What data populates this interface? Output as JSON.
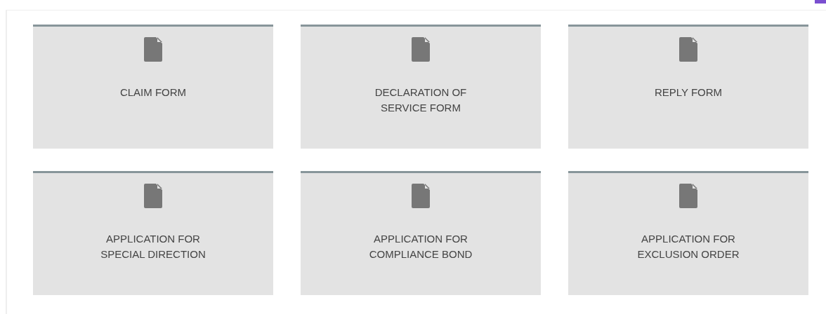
{
  "forms": [
    {
      "label": "CLAIM FORM"
    },
    {
      "label": "DECLARATION OF\nSERVICE FORM"
    },
    {
      "label": "REPLY FORM"
    },
    {
      "label": "APPLICATION FOR\nSPECIAL DIRECTION"
    },
    {
      "label": "APPLICATION FOR\nCOMPLIANCE BOND"
    },
    {
      "label": "APPLICATION FOR\nEXCLUSION ORDER"
    }
  ]
}
